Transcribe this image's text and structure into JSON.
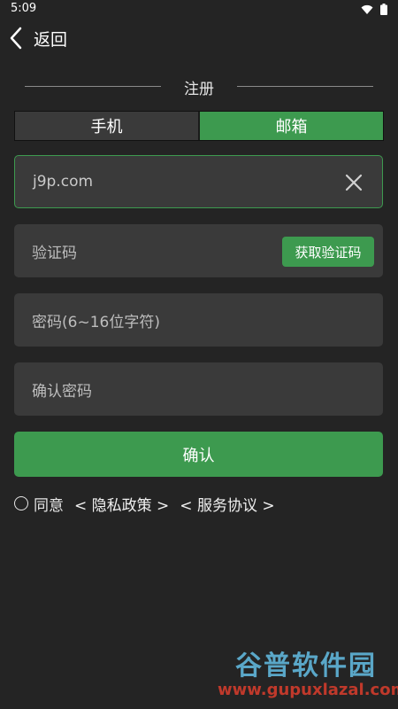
{
  "status": {
    "time": "5:09",
    "wifi_icon": "wifi-icon",
    "battery_icon": "battery-icon"
  },
  "nav": {
    "back_label": "返回",
    "back_icon": "chevron-left-icon"
  },
  "section": {
    "title": "注册"
  },
  "tabs": [
    {
      "label": "手机",
      "active": false
    },
    {
      "label": "邮箱",
      "active": true
    }
  ],
  "form": {
    "email_value": "j9p.com",
    "code_placeholder": "验证码",
    "get_code_label": "获取验证码",
    "password_placeholder": "密码(6~16位字符)",
    "confirm_password_placeholder": "确认密码",
    "confirm_label": "确认"
  },
  "agreement": {
    "agree_label": "同意",
    "privacy_link": "< 隐私政策 >",
    "terms_link": "< 服务协议 >"
  },
  "watermark": {
    "title": "谷普软件园",
    "url": "www.gupuxlazal.com"
  },
  "colors": {
    "accent": "#3d9a4f",
    "background": "#242424",
    "field": "#3a3a3a"
  }
}
